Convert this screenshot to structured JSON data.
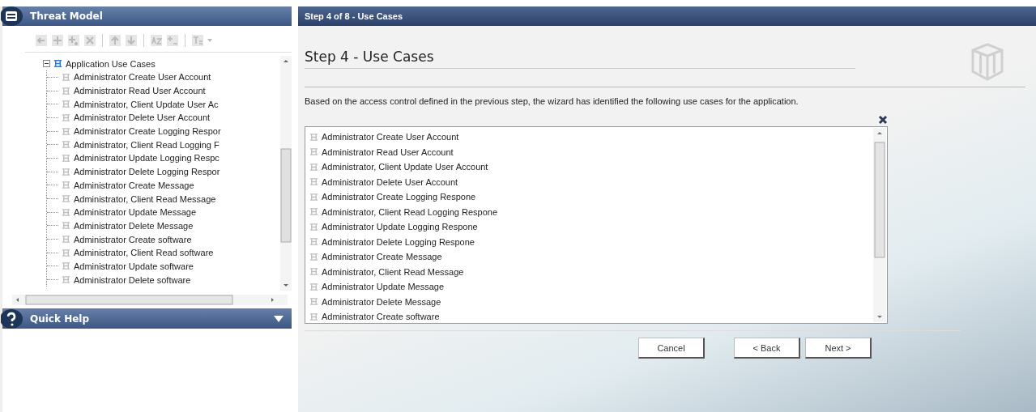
{
  "left_panel": {
    "title": "Threat Model",
    "tree": [
      {
        "label": "Application Use Cases",
        "expanded": true,
        "children": [
          {
            "label": "Administrator Create User Account"
          },
          {
            "label": "Administrator Read User Account"
          },
          {
            "label": "Administrator, Client Update User Ac"
          },
          {
            "label": "Administrator Delete User Account"
          },
          {
            "label": "Administrator Create Logging Respor"
          },
          {
            "label": "Administrator, Client Read Logging F"
          },
          {
            "label": "Administrator Update Logging Respc"
          },
          {
            "label": "Administrator Delete Logging Respor"
          },
          {
            "label": "Administrator Create Message"
          },
          {
            "label": "Administrator, Client Read Message"
          },
          {
            "label": "Administrator Update Message"
          },
          {
            "label": "Administrator Delete Message"
          },
          {
            "label": "Administrator Create software"
          },
          {
            "label": "Administrator, Client Read software"
          },
          {
            "label": "Administrator Update software"
          },
          {
            "label": "Administrator Delete software"
          }
        ]
      }
    ],
    "quick_help": {
      "title": "Quick Help",
      "expanded": false
    }
  },
  "wizard": {
    "header": "Step 4 of 8 - Use Cases",
    "heading": "Step 4 - Use Cases",
    "description": "Based on the access control defined in the previous step, the wizard has identified the following use cases for the application.",
    "use_cases": [
      "Administrator Create User Account",
      "Administrator Read User Account",
      "Administrator, Client Update User Account",
      "Administrator Delete User Account",
      "Administrator Create Logging Respone",
      "Administrator, Client Read Logging Respone",
      "Administrator Update Logging Respone",
      "Administrator Delete Logging Respone",
      "Administrator Create Message",
      "Administrator, Client Read Message",
      "Administrator Update Message",
      "Administrator Delete Message",
      "Administrator Create software"
    ],
    "buttons": [
      "Cancel",
      "< Back",
      "Next >"
    ]
  }
}
